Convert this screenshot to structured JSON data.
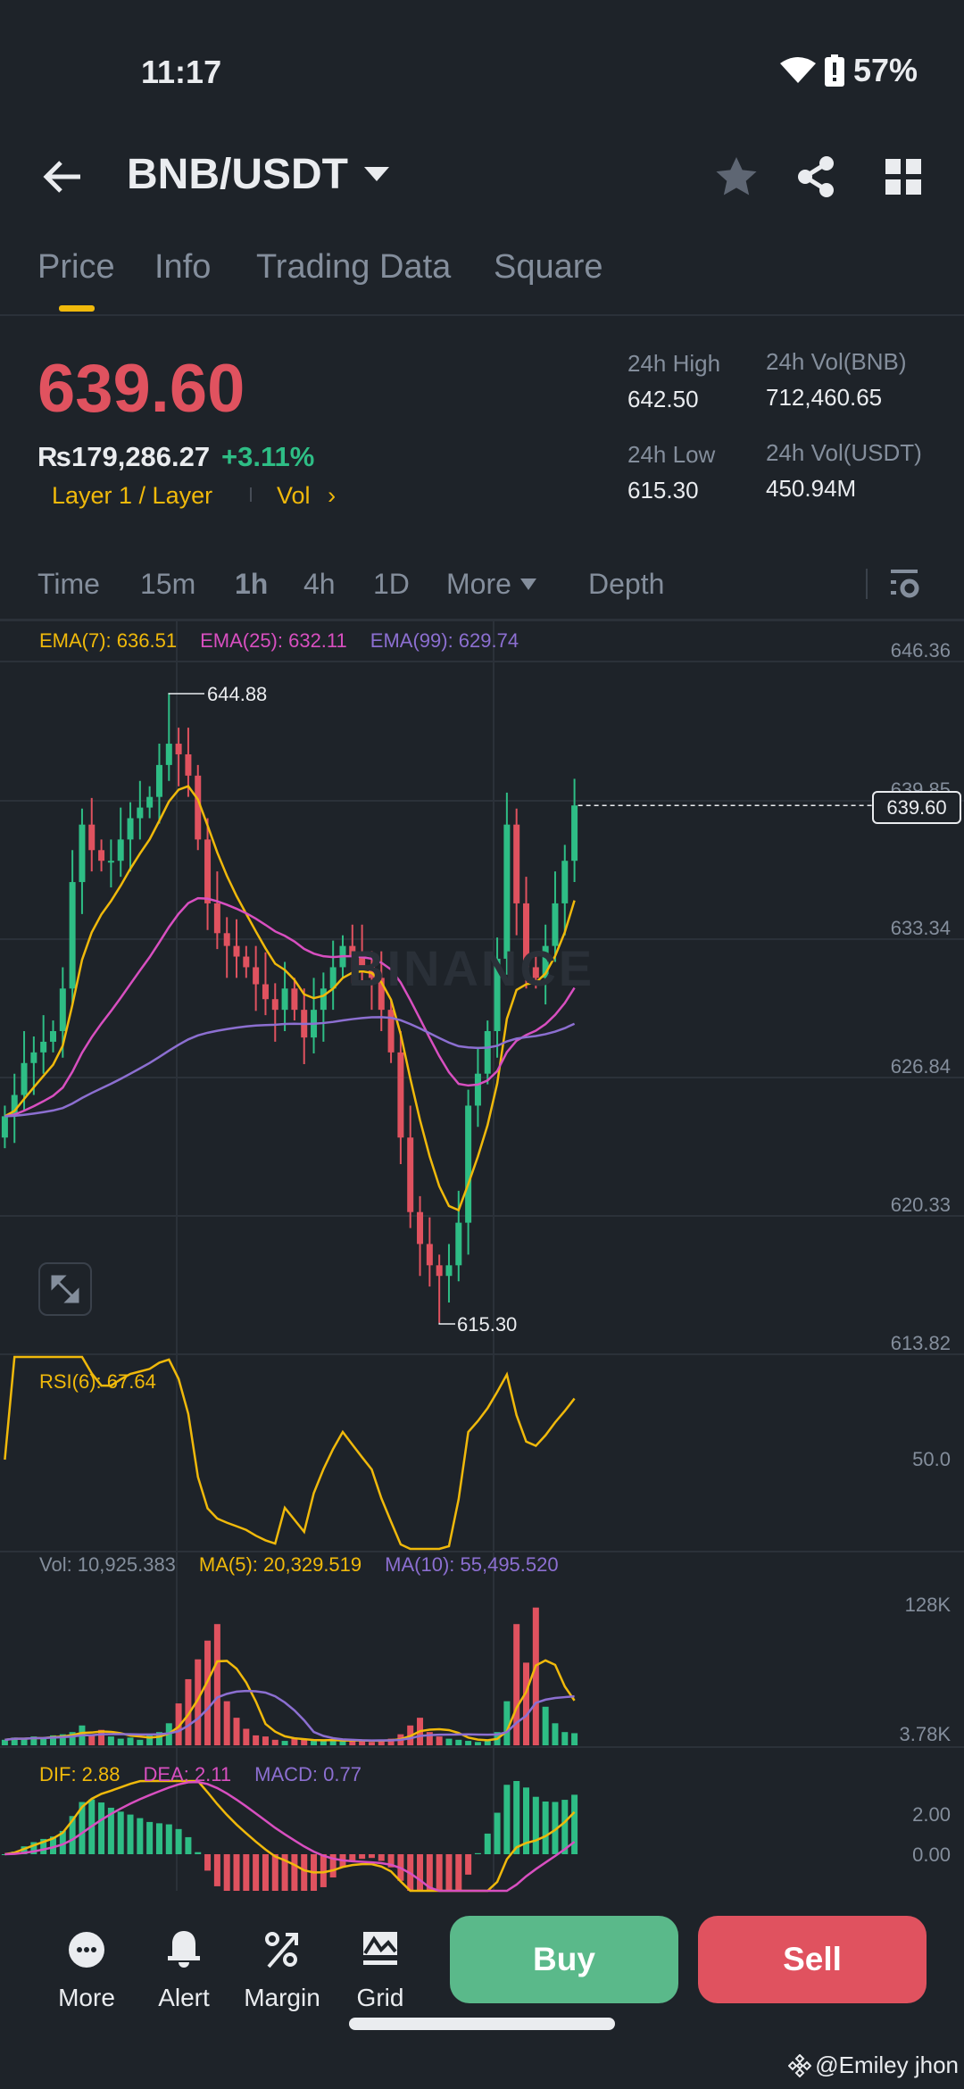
{
  "status": {
    "time": "11:17",
    "battery": "57%"
  },
  "header": {
    "pair": "BNB/USDT"
  },
  "tabs": [
    "Price",
    "Info",
    "Trading Data",
    "Square"
  ],
  "ticker": {
    "last_price": "639.60",
    "fiat_price": "₨179,286.27",
    "change": "+3.11%",
    "sector": "Layer 1 / Layer",
    "vol_link": "Vol",
    "high_label": "24h High",
    "high": "642.50",
    "low_label": "24h Low",
    "low": "615.30",
    "vol_base_label": "24h Vol(BNB)",
    "vol_base": "712,460.65",
    "vol_quote_label": "24h Vol(USDT)",
    "vol_quote": "450.94M"
  },
  "intervals": [
    "Time",
    "15m",
    "1h",
    "4h",
    "1D",
    "More",
    "Depth"
  ],
  "indicators": {
    "ema7": "EMA(7): 636.51",
    "ema25": "EMA(25): 632.11",
    "ema99": "EMA(99): 629.74",
    "rsi": "RSI(6): 67.64",
    "vol": "Vol: 10,925.383",
    "ma5": "MA(5): 20,329.519",
    "ma10": "MA(10): 55,495.520",
    "dif": "DIF: 2.88",
    "dea": "DEA: 2.11",
    "macd": "MACD: 0.77"
  },
  "axes": {
    "price": [
      "646.36",
      "639.85",
      "633.34",
      "626.84",
      "620.33",
      "613.82"
    ],
    "rsi": "50.0",
    "vol": [
      "128K",
      "3.78K"
    ],
    "macd": [
      "2.00",
      "0.00"
    ]
  },
  "markers": {
    "high": "644.88",
    "low": "615.30",
    "current": "639.60"
  },
  "watermark": "BINANCE",
  "bottom": {
    "more": "More",
    "alert": "Alert",
    "margin": "Margin",
    "grid": "Grid",
    "buy": "Buy",
    "sell": "Sell"
  },
  "credit": "@Emiley jhon",
  "colors": {
    "up": "#2ebd85",
    "down": "#e0525f",
    "accent": "#f0b90b",
    "ema7": "#f0b90b",
    "ema25": "#d84fc0",
    "ema99": "#8c6fd1"
  },
  "chart_data": {
    "type": "candlestick",
    "interval": "1h",
    "ylim": [
      613.82,
      646.36
    ],
    "high_marker": {
      "index": 17,
      "value": 644.88
    },
    "low_marker": {
      "index": 45,
      "value": 615.3
    },
    "open_first": 624.0,
    "closes": [
      625,
      626,
      627.5,
      628,
      628.5,
      629,
      631,
      636,
      638.7,
      637.5,
      637,
      637,
      638,
      639,
      639.5,
      640,
      641.5,
      642.5,
      642,
      641,
      638,
      635,
      633.6,
      633,
      632.5,
      632,
      631.2,
      630.5,
      630,
      631,
      630,
      628.7,
      630,
      631,
      632,
      633,
      632.5,
      632,
      631.5,
      630,
      628,
      624,
      620.5,
      619,
      618,
      617.5,
      618,
      620,
      625.5,
      627,
      629,
      632.4,
      638.7,
      635,
      632,
      631.5,
      633,
      635,
      637,
      639.6
    ],
    "volumes_k": [
      5,
      7,
      6,
      8,
      7,
      9,
      10,
      12,
      18,
      9,
      14,
      8,
      6,
      7,
      5,
      9,
      12,
      20,
      38,
      60,
      78,
      95,
      110,
      40,
      25,
      15,
      9,
      8,
      5,
      4,
      6,
      5,
      4,
      4,
      5,
      4,
      5,
      4,
      3,
      5,
      6,
      10,
      18,
      25,
      12,
      8,
      6,
      5,
      4,
      3,
      5,
      12,
      40,
      110,
      75,
      125,
      35,
      20,
      12,
      11
    ]
  }
}
